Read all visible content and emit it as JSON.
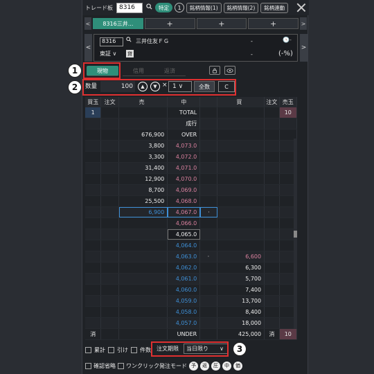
{
  "titlebar": {
    "title": "トレード板",
    "code": "8316",
    "search_icon": "🔍",
    "tokutei": "特定",
    "account_num": "1",
    "btn_info1": "銘柄情報(1)",
    "btn_info2": "銘柄情報(2)",
    "btn_link": "銘柄連動"
  },
  "tabs": {
    "active": "8316三井...",
    "plus": "+"
  },
  "stock": {
    "code": "8316",
    "name": "三井住友ＦＧ",
    "market": "東証 ∨",
    "kashi": "貸",
    "price_dash": "-",
    "change_dash": "-",
    "clock": "🕓-",
    "pct": "(-%)"
  },
  "order_types": {
    "genbutsu": "現物",
    "shinyo": "信用",
    "hensai": "返済"
  },
  "quantity": {
    "label": "数量",
    "value": "100",
    "up": "▲",
    "down": "▼",
    "times": "×",
    "multiplier": "1 ∨",
    "all": "全数",
    "clear": "C"
  },
  "board_header": [
    "買玉",
    "注文",
    "売",
    "中",
    "",
    "買",
    "注文",
    "売玉"
  ],
  "board_rows": [
    {
      "bq": "1",
      "ask": "",
      "mid": "TOTAL",
      "bid": "",
      "sq": "10",
      "type": "special"
    },
    {
      "bq": "",
      "ask": "",
      "mid": "成行",
      "bid": "",
      "sq": "",
      "type": "special"
    },
    {
      "bq": "",
      "ask": "676,900",
      "mid": "OVER",
      "bid": "",
      "sq": "",
      "type": "special"
    },
    {
      "bq": "",
      "ask": "3,800",
      "mid": "4,073.0",
      "bid": "",
      "sq": "",
      "type": "ask"
    },
    {
      "bq": "",
      "ask": "3,300",
      "mid": "4,072.0",
      "bid": "",
      "sq": "",
      "type": "ask"
    },
    {
      "bq": "",
      "ask": "31,400",
      "mid": "4,071.0",
      "bid": "",
      "sq": "",
      "type": "ask"
    },
    {
      "bq": "",
      "ask": "12,900",
      "mid": "4,070.0",
      "bid": "",
      "sq": "",
      "type": "ask"
    },
    {
      "bq": "",
      "ask": "8,700",
      "mid": "4,069.0",
      "bid": "",
      "sq": "",
      "type": "ask"
    },
    {
      "bq": "",
      "ask": "25,500",
      "mid": "4,068.0",
      "bid": "",
      "sq": "",
      "type": "ask"
    },
    {
      "bq": "",
      "ask": "6,900",
      "mid": "4,067.0",
      "bid": "",
      "sq": "",
      "type": "best-ask",
      "dot": "·"
    },
    {
      "bq": "",
      "ask": "",
      "mid": "4,066.0",
      "bid": "",
      "sq": "",
      "type": "ask"
    },
    {
      "bq": "",
      "ask": "",
      "mid": "4,065.0",
      "bid": "",
      "sq": "",
      "type": "current"
    },
    {
      "bq": "",
      "ask": "",
      "mid": "4,064.0",
      "bid": "",
      "sq": "",
      "type": "bid"
    },
    {
      "bq": "",
      "ask": "",
      "mid": "4,063.0",
      "bid": "6,600",
      "sq": "",
      "type": "best-bid",
      "dot": "·"
    },
    {
      "bq": "",
      "ask": "",
      "mid": "4,062.0",
      "bid": "6,300",
      "sq": "",
      "type": "bid"
    },
    {
      "bq": "",
      "ask": "",
      "mid": "4,061.0",
      "bid": "5,700",
      "sq": "",
      "type": "bid"
    },
    {
      "bq": "",
      "ask": "",
      "mid": "4,060.0",
      "bid": "7,400",
      "sq": "",
      "type": "bid"
    },
    {
      "bq": "",
      "ask": "",
      "mid": "4,059.0",
      "bid": "13,700",
      "sq": "",
      "type": "bid"
    },
    {
      "bq": "",
      "ask": "",
      "mid": "4,058.0",
      "bid": "8,400",
      "sq": "",
      "type": "bid"
    },
    {
      "bq": "",
      "ask": "",
      "mid": "4,057.0",
      "bid": "18,000",
      "sq": "",
      "type": "bid"
    },
    {
      "bq": "消",
      "ask": "",
      "mid": "UNDER",
      "bid": "425,000",
      "sq": "10",
      "type": "special",
      "bidcancel": "消"
    }
  ],
  "bottom": {
    "ruikei": "累計",
    "hike": "引け",
    "kensu": "件数",
    "expiry_label": "注文期限",
    "expiry_value": "当日限り",
    "expiry_chevron": "∨",
    "kakunin": "確認省略",
    "oneclick": "ワンクリック発注モード",
    "c1": "予",
    "c2": "返",
    "c3": "圧",
    "c4": "中",
    "c5": "価"
  },
  "annotations": {
    "n1": "1",
    "n2": "2",
    "n3": "3"
  },
  "colors": {
    "accent": "#2f8f7a",
    "ask": "#3e8fd6",
    "bid": "#d9809e",
    "annotation": "#e03030"
  }
}
